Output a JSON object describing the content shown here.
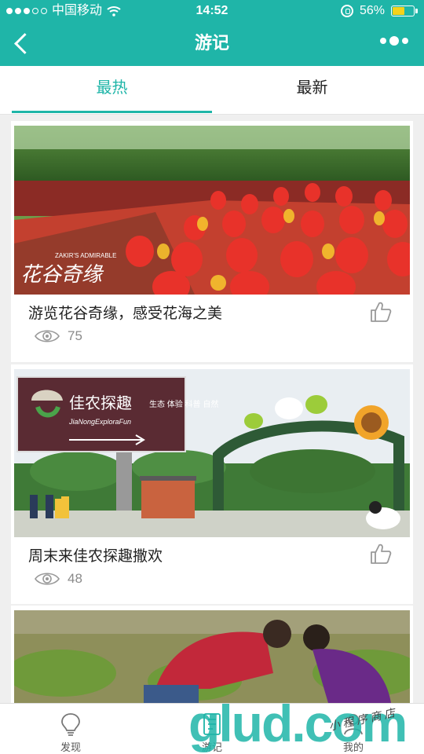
{
  "status_bar": {
    "carrier": "中国移动",
    "time": "14:52",
    "battery": "56%"
  },
  "nav": {
    "title": "游记"
  },
  "tabs": [
    {
      "label": "最热"
    },
    {
      "label": "最新"
    }
  ],
  "posts": [
    {
      "caption": "游览花谷奇缘，感受花海之美",
      "views": "75",
      "image": "red-yellow tulip field photo",
      "image_text": "花谷奇缘",
      "image_small_text": "ZAKIR'S ADMIRABLE"
    },
    {
      "caption": "周末来佳农探趣撒欢",
      "views": "48",
      "image": "farm park entrance with sign photo",
      "sign": {
        "title": "佳农探趣",
        "sub": "JiaNongExploraFun",
        "right": "生态 体验 科普 自然"
      }
    },
    {
      "caption": "",
      "views": "",
      "image": "father and son planting in field photo"
    }
  ],
  "tabbar": [
    {
      "label": "发现",
      "icon": "bulb-icon"
    },
    {
      "label": "游记",
      "icon": "notes-icon"
    },
    {
      "label": "我的",
      "icon": "person-icon"
    }
  ],
  "watermark": {
    "text": "glud.com",
    "handwriting": "小 程 序 商 店"
  },
  "colors": {
    "accent": "#1fb5a8",
    "battery": "#f6d21b"
  }
}
